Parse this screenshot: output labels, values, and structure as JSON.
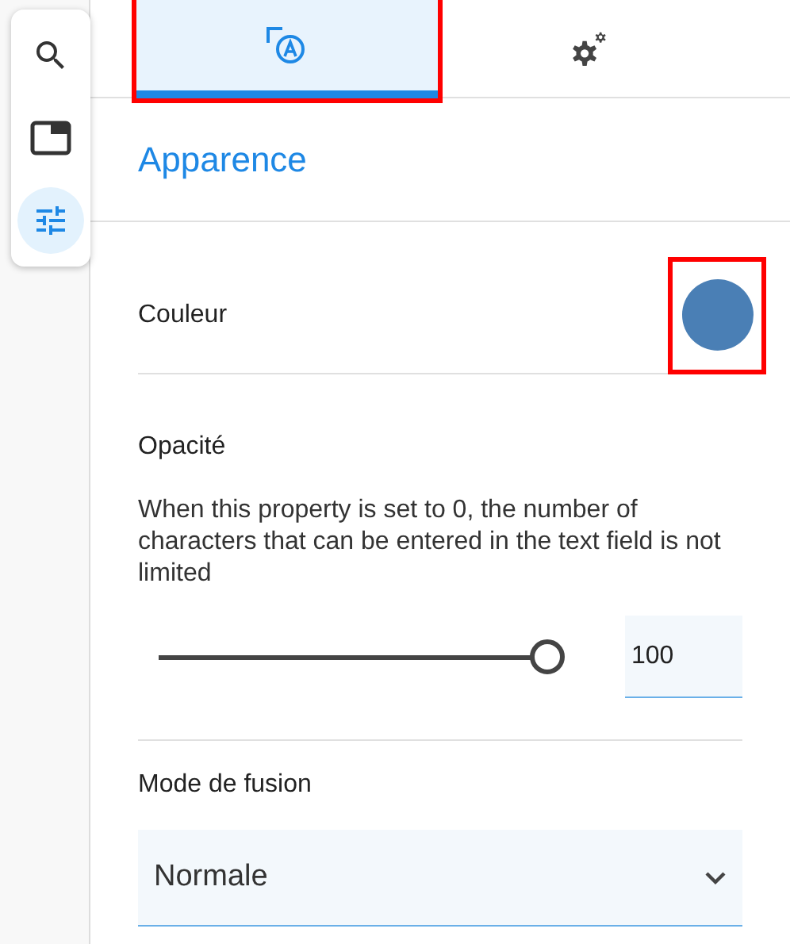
{
  "toolbar": {
    "items": [
      {
        "kind": "search",
        "selected": false
      },
      {
        "kind": "panel",
        "selected": false
      },
      {
        "kind": "sliders",
        "selected": true
      }
    ]
  },
  "tabs": [
    {
      "kind": "appearance",
      "selected": true,
      "highlighted": true
    },
    {
      "kind": "settings",
      "selected": false,
      "highlighted": false
    }
  ],
  "section_title": "Apparence",
  "color_row": {
    "label": "Couleur",
    "color": "#4a7fb5",
    "highlighted": true
  },
  "opacity": {
    "label": "Opacité",
    "description": "When this property is set to 0, the number of characters that can be entered in the text field is not limited",
    "level": 1,
    "value": "100"
  },
  "blend_mode": {
    "label": "Mode de fusion",
    "value": "Normale"
  }
}
